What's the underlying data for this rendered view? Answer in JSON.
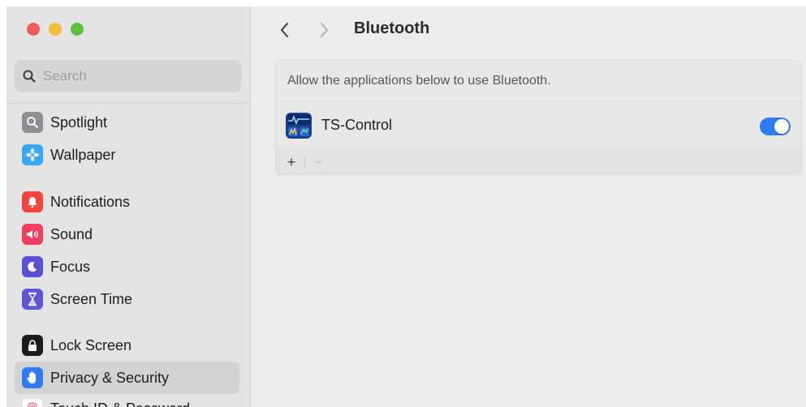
{
  "window": {
    "traffic_lights": {
      "close": "#ee5e57",
      "minimize": "#f4bd3a",
      "zoom": "#5fc23f"
    }
  },
  "search": {
    "placeholder": "Search",
    "value": "",
    "icon": "search-icon"
  },
  "sidebar": {
    "items": [
      {
        "label": "Spotlight",
        "icon": "spotlight-icon",
        "color": "#8e8e93"
      },
      {
        "label": "Wallpaper",
        "icon": "wallpaper-icon",
        "color": "#3aa7f5"
      },
      {
        "label": "Notifications",
        "icon": "notifications-icon",
        "color": "#f2453d"
      },
      {
        "label": "Sound",
        "icon": "sound-icon",
        "color": "#f23e5c"
      },
      {
        "label": "Focus",
        "icon": "focus-icon",
        "color": "#5b4fd6"
      },
      {
        "label": "Screen Time",
        "icon": "screen-time-icon",
        "color": "#5e55d8"
      },
      {
        "label": "Lock Screen",
        "icon": "lock-screen-icon",
        "color": "#1c1c1e"
      },
      {
        "label": "Privacy & Security",
        "icon": "privacy-hand-icon",
        "color": "#2f7cf6",
        "selected": true
      },
      {
        "label": "Touch ID & Password",
        "icon": "fingerprint-icon",
        "color": "#ffffff"
      }
    ]
  },
  "main": {
    "title": "Bluetooth",
    "panel": {
      "description": "Allow the applications below to use Bluetooth.",
      "apps": [
        {
          "name": "TS-Control",
          "icon": "ts-control-app-icon",
          "enabled": true
        }
      ],
      "add_label": "+",
      "remove_label": "−"
    }
  },
  "colors": {
    "accent": "#2f7cf6"
  }
}
